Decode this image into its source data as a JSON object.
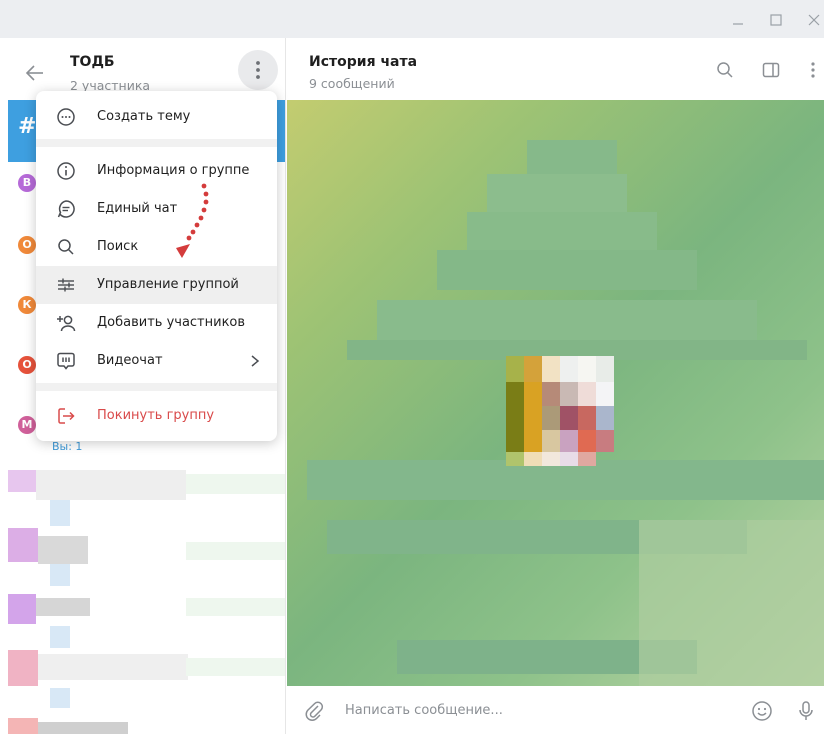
{
  "group": {
    "title": "ТОДБ",
    "members": "2 участника"
  },
  "topics_partial_text": "Вы: 1",
  "avatars": [
    {
      "letter": "В",
      "color": "#b66ad8"
    },
    {
      "letter": "О",
      "color": "#f0893a"
    },
    {
      "letter": "К",
      "color": "#f0893a"
    },
    {
      "letter": "О",
      "color": "#e6523b"
    },
    {
      "letter": "М",
      "color": "#d0609a"
    }
  ],
  "menu": {
    "create_topic": "Создать тему",
    "group_info": "Информация о группе",
    "single_chat": "Единый чат",
    "search": "Поиск",
    "manage_group": "Управление группой",
    "add_members": "Добавить участников",
    "video_chat": "Видеочат",
    "leave_group": "Покинуть группу"
  },
  "chat": {
    "title": "История чата",
    "message_count": "9 сообщений",
    "input_placeholder": "Написать сообщение...",
    "input_value": ""
  },
  "colors": {
    "accent": "#3e9fe0",
    "danger": "#d94a4a",
    "annotation": "#d43c3c"
  },
  "icons": {
    "back": "arrow-left-icon",
    "more": "three-dots-vertical-icon",
    "search": "search-icon",
    "side_panel": "side-panel-icon",
    "attach": "paperclip-icon",
    "emoji": "smiley-icon",
    "mic": "microphone-icon"
  }
}
